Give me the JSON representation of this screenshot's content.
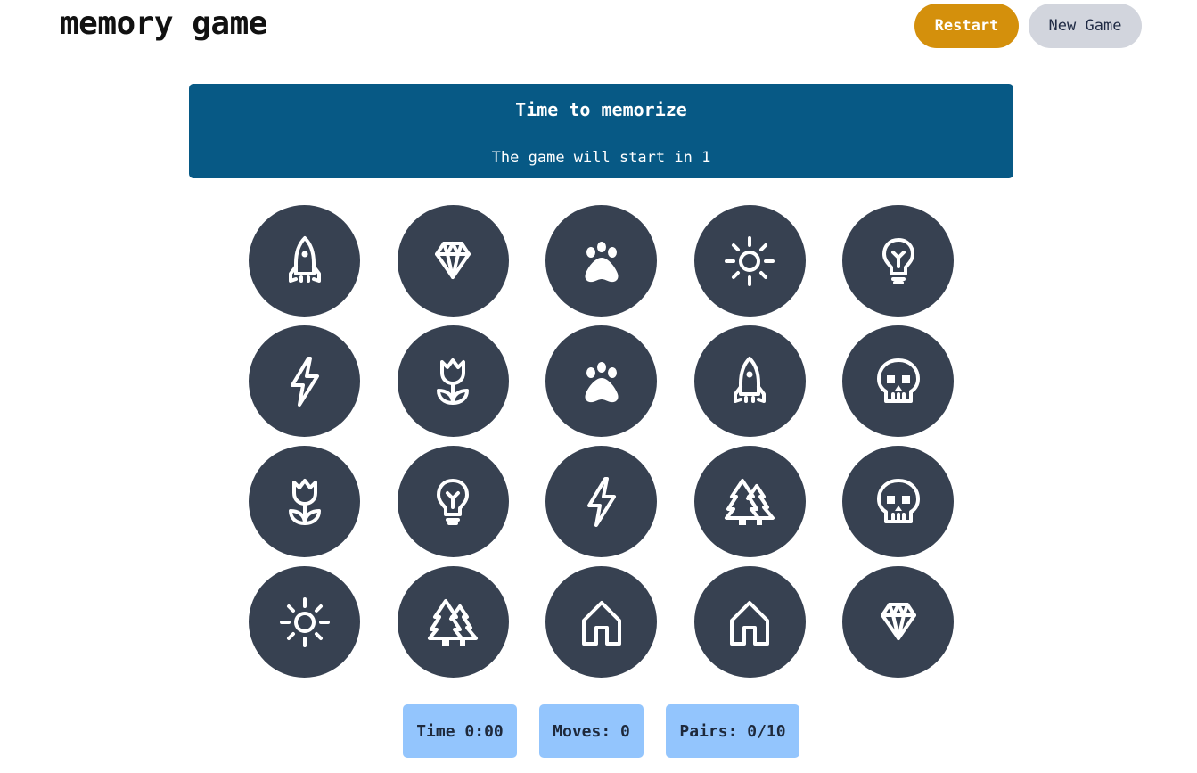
{
  "header": {
    "title": "memory game",
    "restart_label": "Restart",
    "new_game_label": "New Game"
  },
  "banner": {
    "title": "Time to memorize",
    "subtitle": "The game will start in 1"
  },
  "board": {
    "cards": [
      [
        "rocket",
        "diamond",
        "paw",
        "sun",
        "lightbulb"
      ],
      [
        "bolt",
        "tulip",
        "paw",
        "rocket",
        "skull"
      ],
      [
        "tulip",
        "lightbulb",
        "bolt",
        "trees",
        "skull"
      ],
      [
        "sun",
        "trees",
        "house",
        "house",
        "diamond"
      ]
    ]
  },
  "stats": {
    "time": "Time 0:00",
    "moves": "Moves: 0",
    "pairs": "Pairs: 0/10"
  },
  "colors": {
    "restart": "#d4900c",
    "new_game": "#d2d5dd",
    "banner": "#075985",
    "card": "#374151",
    "stat": "#93c5fd"
  }
}
